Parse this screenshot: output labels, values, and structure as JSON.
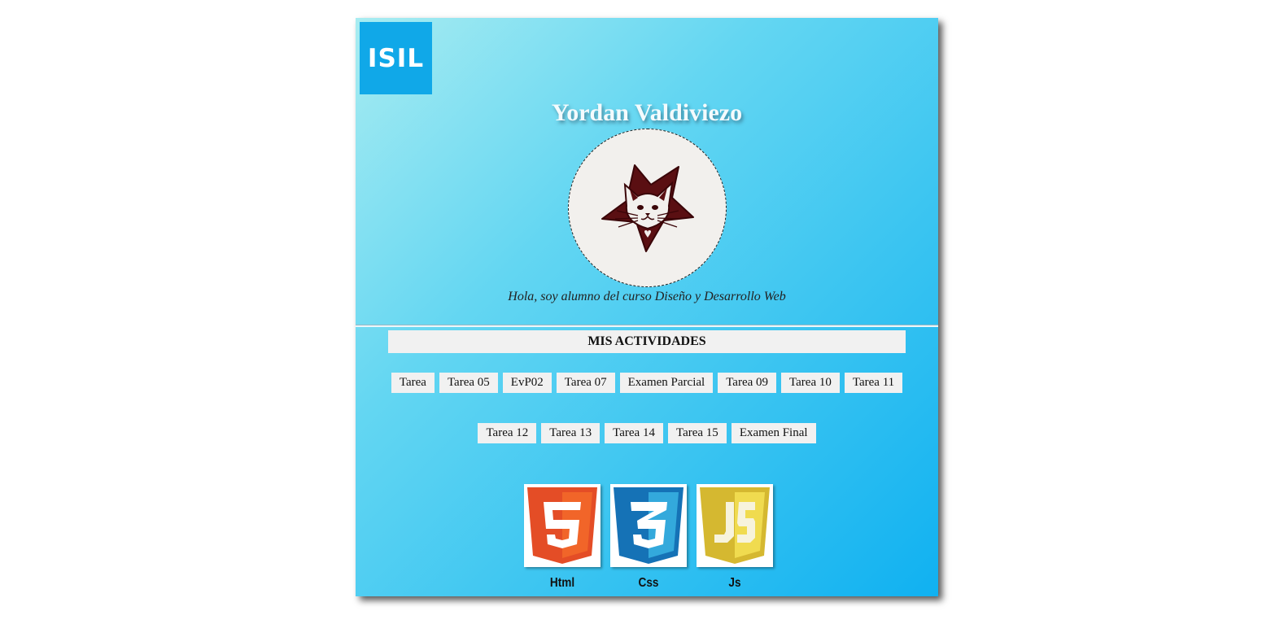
{
  "logo": {
    "text": "ISIL",
    "color": "#10a8e8"
  },
  "profile": {
    "name": "Yordan Valdiviezo",
    "intro": "Hola, soy alumno del curso Diseño y Desarrollo Web",
    "avatar_icon": "cat-star-icon"
  },
  "activities": {
    "title": "MIS ACTIVIDADES",
    "row1": [
      "Tarea",
      "Tarea 05",
      "EvP02",
      "Tarea 07",
      "Examen Parcial",
      "Tarea 09",
      "Tarea 10",
      "Tarea 11"
    ],
    "row2": [
      "Tarea 12",
      "Tarea 13",
      "Tarea 14",
      "Tarea 15",
      "Examen Final"
    ]
  },
  "technologies": [
    {
      "label": "Html",
      "digit": "5",
      "icon": "html5-icon",
      "color": "#e44d26",
      "light": "#f16529"
    },
    {
      "label": "Css",
      "digit": "3",
      "icon": "css3-icon",
      "color": "#1572b6",
      "light": "#33a9dc"
    },
    {
      "label": "Js",
      "digit": "JS",
      "icon": "js-icon",
      "color": "#d5b830",
      "light": "#f0db4f"
    }
  ]
}
